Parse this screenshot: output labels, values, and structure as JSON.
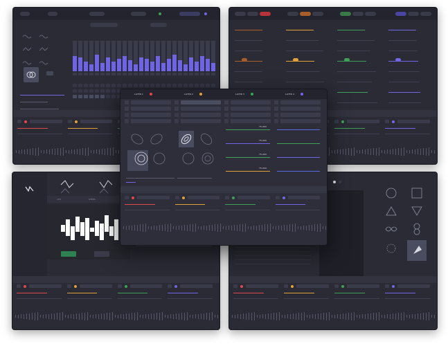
{
  "colors": {
    "bg": "#2a2b35",
    "accent_purple": "#7267e6",
    "accent_green": "#3fa05a",
    "accent_red": "#e0484e",
    "accent_orange": "#e1a23a",
    "accent_blue": "#5a6de0"
  },
  "tl": {
    "bars": [
      22,
      20,
      14,
      10,
      24,
      12,
      20,
      14,
      18,
      22,
      16,
      10,
      20,
      18,
      14,
      22,
      12,
      18,
      24,
      16,
      10,
      20,
      14,
      22,
      18,
      12
    ],
    "label_a": "ON",
    "label_b": "OFF"
  },
  "center": {
    "layers": [
      "LAYER 1",
      "LAYER 2",
      "LAYER 3",
      "LAYER 4"
    ],
    "readouts": [
      "75.000",
      "75.000",
      "75.000",
      "75.000"
    ],
    "slot_a": "SLOT A",
    "slot_b": "SLOT B"
  },
  "bl": {
    "tab_labels": [
      "LFO",
      "STEPS",
      "SHAPE"
    ]
  },
  "br": {
    "shapes": [
      "circle",
      "square",
      "triangle",
      "triangle-down",
      "infinity",
      "eight",
      "dots",
      "star"
    ]
  }
}
